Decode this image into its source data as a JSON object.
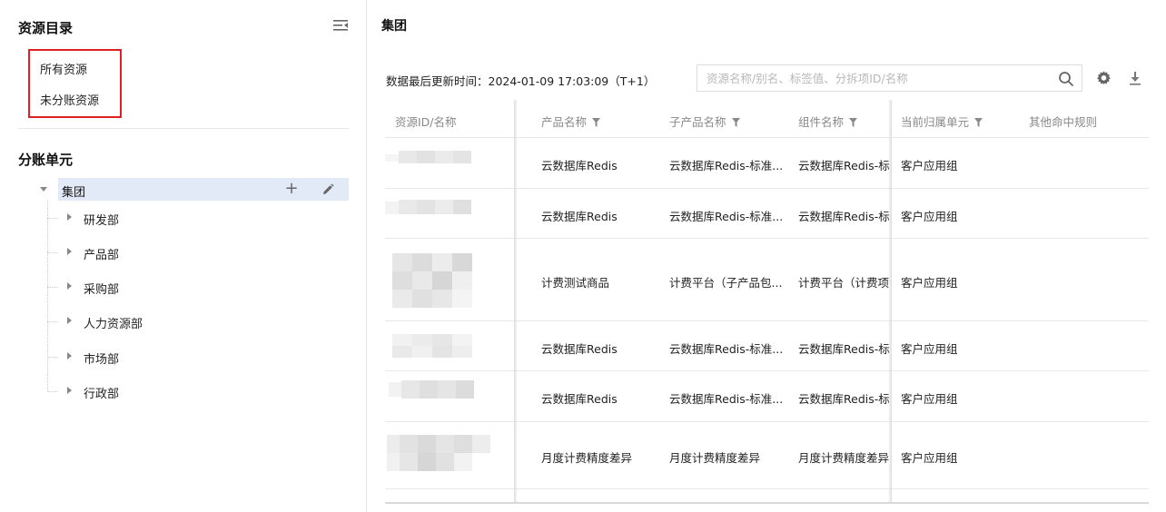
{
  "sidebar": {
    "title": "资源目录",
    "resource_items": [
      {
        "label": "所有资源"
      },
      {
        "label": "未分账资源"
      }
    ],
    "unit_title": "分账单元",
    "tree": {
      "root": "集团",
      "children": [
        {
          "label": "研发部"
        },
        {
          "label": "产品部"
        },
        {
          "label": "采购部"
        },
        {
          "label": "人力资源部"
        },
        {
          "label": "市场部"
        },
        {
          "label": "行政部"
        }
      ]
    }
  },
  "main": {
    "title": "集团",
    "update_time": "数据最后更新时间：2024-01-09 17:03:09（T+1）",
    "search": {
      "placeholder": "资源名称/别名、标签值、分拆项ID/名称"
    },
    "table": {
      "headers": [
        "资源ID/名称",
        "产品名称",
        "子产品名称",
        "组件名称",
        "当前归属单元",
        "其他命中规则"
      ],
      "rows": [
        {
          "product": "云数据库Redis",
          "subproduct": "云数据库Redis-标准...",
          "component": "云数据库Redis-标准",
          "unit": "客户应用组",
          "other": ""
        },
        {
          "product": "云数据库Redis",
          "subproduct": "云数据库Redis-标准...",
          "component": "云数据库Redis-标准",
          "unit": "客户应用组",
          "other": ""
        },
        {
          "product": "计费测试商品",
          "subproduct": "计费平台（子产品包...",
          "component": "计费平台（计费项包",
          "unit": "客户应用组",
          "other": ""
        },
        {
          "product": "云数据库Redis",
          "subproduct": "云数据库Redis-标准...",
          "component": "云数据库Redis-标准",
          "unit": "客户应用组",
          "other": ""
        },
        {
          "product": "云数据库Redis",
          "subproduct": "云数据库Redis-标准...",
          "component": "云数据库Redis-标准",
          "unit": "客户应用组",
          "other": ""
        },
        {
          "product": "月度计费精度差异",
          "subproduct": "月度计费精度差异",
          "component": "月度计费精度差异",
          "unit": "客户应用组",
          "other": ""
        }
      ]
    }
  },
  "colors": {
    "highlight": "#e02020",
    "tree_selected": "#e3eaf7"
  }
}
